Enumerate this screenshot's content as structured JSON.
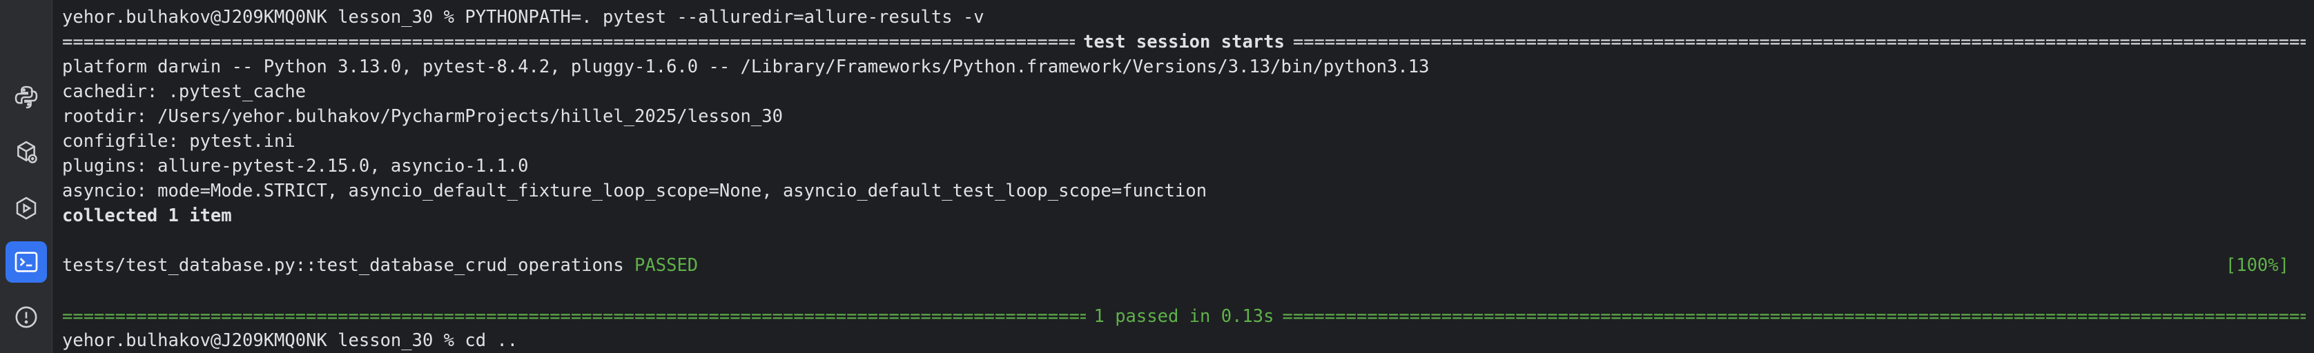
{
  "sidebar": {
    "items": [
      {
        "name": "python-console-icon",
        "active": false
      },
      {
        "name": "python-packages-icon",
        "active": false
      },
      {
        "name": "services-icon",
        "active": false
      },
      {
        "name": "terminal-icon",
        "active": true
      },
      {
        "name": "problems-icon",
        "active": false
      }
    ]
  },
  "terminal": {
    "command_prompt": "yehor.bulhakov@J209KMQ0NK lesson_30 % PYTHONPATH=. pytest --alluredir=allure-results -v",
    "session_header": "test session starts",
    "platform": "platform darwin -- Python 3.13.0, pytest-8.4.2, pluggy-1.6.0 -- /Library/Frameworks/Python.framework/Versions/3.13/bin/python3.13",
    "cachedir": "cachedir: .pytest_cache",
    "rootdir": "rootdir: /Users/yehor.bulhakov/PycharmProjects/hillel_2025/lesson_30",
    "configfile": "configfile: pytest.ini",
    "plugins": "plugins: allure-pytest-2.15.0, asyncio-1.1.0",
    "asyncio": "asyncio: mode=Mode.STRICT, asyncio_default_fixture_loop_scope=None, asyncio_default_test_loop_scope=function",
    "collected": "collected 1 item",
    "test_name": "tests/test_database.py::test_database_crud_operations",
    "test_status": "PASSED",
    "test_progress": "[100%]",
    "summary": "1 passed in 0.13s",
    "last_prompt": "yehor.bulhakov@J209KMQ0NK lesson_30 % cd .."
  },
  "colors": {
    "background": "#1e1f22",
    "sidebar": "#2b2d30",
    "accent": "#3574f0",
    "text": "#dfe1e5",
    "success": "#5fb14a"
  }
}
